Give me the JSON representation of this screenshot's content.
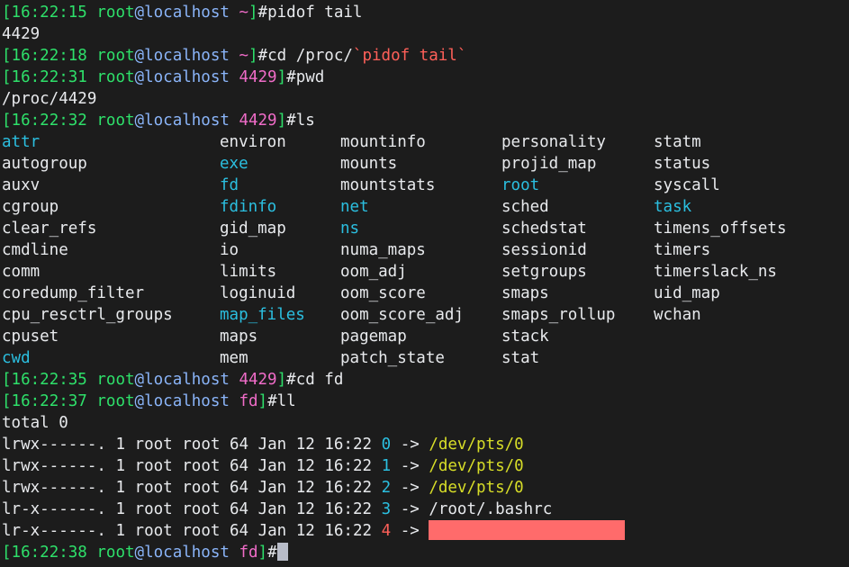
{
  "terminal": {
    "background_color": "#1c1c1c",
    "foreground_color": "#e0e2e4",
    "cursor_color": "#b8bcc8",
    "highlight_color": "#ff6b6b",
    "palette": {
      "green": "#2ee06a",
      "blue": "#8ab4f8",
      "magenta": "#f06cc8",
      "cyan": "#2bbfe0",
      "yellow": "#d8de28",
      "red": "#ff6059",
      "white": "#e8eaed"
    }
  },
  "prompts": {
    "p1": {
      "bracket_open": "[",
      "time": "16:22:15",
      "space": " ",
      "user": "root",
      "at_host": "@localhost",
      "sep": " ",
      "path": "~",
      "bracket_close": "]",
      "hash": "#",
      "command": "pidof tail"
    },
    "p2": {
      "bracket_open": "[",
      "time": "16:22:18",
      "user": "root",
      "at_host": "@localhost",
      "path": "~",
      "bracket_close": "]",
      "hash": "#",
      "command_plain": "cd /proc/",
      "command_sub": "`pidof tail`"
    },
    "p3": {
      "bracket_open": "[",
      "time": "16:22:31",
      "user": "root",
      "at_host": "@localhost",
      "path": "4429",
      "bracket_close": "]",
      "hash": "#",
      "command": "pwd"
    },
    "p4": {
      "bracket_open": "[",
      "time": "16:22:32",
      "user": "root",
      "at_host": "@localhost",
      "path": "4429",
      "bracket_close": "]",
      "hash": "#",
      "command": "ls"
    },
    "p5": {
      "bracket_open": "[",
      "time": "16:22:35",
      "user": "root",
      "at_host": "@localhost",
      "path": "4429",
      "bracket_close": "]",
      "hash": "#",
      "command": "cd fd"
    },
    "p6": {
      "bracket_open": "[",
      "time": "16:22:37",
      "user": "root",
      "at_host": "@localhost",
      "path": "fd",
      "bracket_close": "]",
      "hash": "#",
      "command": "ll"
    },
    "p7": {
      "bracket_open": "[",
      "time": "16:22:38",
      "user": "root",
      "at_host": "@localhost",
      "path": "fd",
      "bracket_close": "]",
      "hash": "#",
      "command": ""
    }
  },
  "outputs": {
    "pidof_result": "4429",
    "pwd_result": "/proc/4429",
    "ll_total": "total 0"
  },
  "ls_listing": {
    "columns": [
      [
        {
          "name": "attr",
          "color": "cyan"
        },
        {
          "name": "autogroup",
          "color": "white"
        },
        {
          "name": "auxv",
          "color": "white"
        },
        {
          "name": "cgroup",
          "color": "white"
        },
        {
          "name": "clear_refs",
          "color": "white"
        },
        {
          "name": "cmdline",
          "color": "white"
        },
        {
          "name": "comm",
          "color": "white"
        },
        {
          "name": "coredump_filter",
          "color": "white"
        },
        {
          "name": "cpu_resctrl_groups",
          "color": "white"
        },
        {
          "name": "cpuset",
          "color": "white"
        },
        {
          "name": "cwd",
          "color": "cyan"
        }
      ],
      [
        {
          "name": "environ",
          "color": "white"
        },
        {
          "name": "exe",
          "color": "cyan"
        },
        {
          "name": "fd",
          "color": "cyan"
        },
        {
          "name": "fdinfo",
          "color": "cyan"
        },
        {
          "name": "gid_map",
          "color": "white"
        },
        {
          "name": "io",
          "color": "white"
        },
        {
          "name": "limits",
          "color": "white"
        },
        {
          "name": "loginuid",
          "color": "white"
        },
        {
          "name": "map_files",
          "color": "cyan"
        },
        {
          "name": "maps",
          "color": "white"
        },
        {
          "name": "mem",
          "color": "white"
        }
      ],
      [
        {
          "name": "mountinfo",
          "color": "white"
        },
        {
          "name": "mounts",
          "color": "white"
        },
        {
          "name": "mountstats",
          "color": "white"
        },
        {
          "name": "net",
          "color": "cyan"
        },
        {
          "name": "ns",
          "color": "cyan"
        },
        {
          "name": "numa_maps",
          "color": "white"
        },
        {
          "name": "oom_adj",
          "color": "white"
        },
        {
          "name": "oom_score",
          "color": "white"
        },
        {
          "name": "oom_score_adj",
          "color": "white"
        },
        {
          "name": "pagemap",
          "color": "white"
        },
        {
          "name": "patch_state",
          "color": "white"
        }
      ],
      [
        {
          "name": "personality",
          "color": "white"
        },
        {
          "name": "projid_map",
          "color": "white"
        },
        {
          "name": "root",
          "color": "cyan"
        },
        {
          "name": "sched",
          "color": "white"
        },
        {
          "name": "schedstat",
          "color": "white"
        },
        {
          "name": "sessionid",
          "color": "white"
        },
        {
          "name": "setgroups",
          "color": "white"
        },
        {
          "name": "smaps",
          "color": "white"
        },
        {
          "name": "smaps_rollup",
          "color": "white"
        },
        {
          "name": "stack",
          "color": "white"
        },
        {
          "name": "stat",
          "color": "white"
        }
      ],
      [
        {
          "name": "statm",
          "color": "white"
        },
        {
          "name": "status",
          "color": "white"
        },
        {
          "name": "syscall",
          "color": "white"
        },
        {
          "name": "task",
          "color": "cyan"
        },
        {
          "name": "timens_offsets",
          "color": "white"
        },
        {
          "name": "timers",
          "color": "white"
        },
        {
          "name": "timerslack_ns",
          "color": "white"
        },
        {
          "name": "uid_map",
          "color": "white"
        },
        {
          "name": "wchan",
          "color": "white"
        }
      ]
    ]
  },
  "ll_listing": {
    "rows": [
      {
        "perms": "lrwx------.",
        "links": "1",
        "owner": "root",
        "group": "root",
        "size": "64",
        "month": "Jan",
        "day": "12",
        "time": "16:22",
        "name": "0",
        "name_color": "cyan",
        "arrow": "->",
        "target": "/dev/pts/0",
        "target_color": "yellow",
        "target_highlight": false
      },
      {
        "perms": "lrwx------.",
        "links": "1",
        "owner": "root",
        "group": "root",
        "size": "64",
        "month": "Jan",
        "day": "12",
        "time": "16:22",
        "name": "1",
        "name_color": "cyan",
        "arrow": "->",
        "target": "/dev/pts/0",
        "target_color": "yellow",
        "target_highlight": false
      },
      {
        "perms": "lrwx------.",
        "links": "1",
        "owner": "root",
        "group": "root",
        "size": "64",
        "month": "Jan",
        "day": "12",
        "time": "16:22",
        "name": "2",
        "name_color": "cyan",
        "arrow": "->",
        "target": "/dev/pts/0",
        "target_color": "yellow",
        "target_highlight": false
      },
      {
        "perms": "lr-x------.",
        "links": "1",
        "owner": "root",
        "group": "root",
        "size": "64",
        "month": "Jan",
        "day": "12",
        "time": "16:22",
        "name": "3",
        "name_color": "cyan",
        "arrow": "->",
        "target": "/root/.bashrc",
        "target_color": "white",
        "target_highlight": false
      },
      {
        "perms": "lr-x------.",
        "links": "1",
        "owner": "root",
        "group": "root",
        "size": "64",
        "month": "Jan",
        "day": "12",
        "time": "16:22",
        "name": "4",
        "name_color": "red",
        "arrow": "->",
        "target": "                  ",
        "target_color": "white",
        "target_highlight": true
      }
    ]
  }
}
